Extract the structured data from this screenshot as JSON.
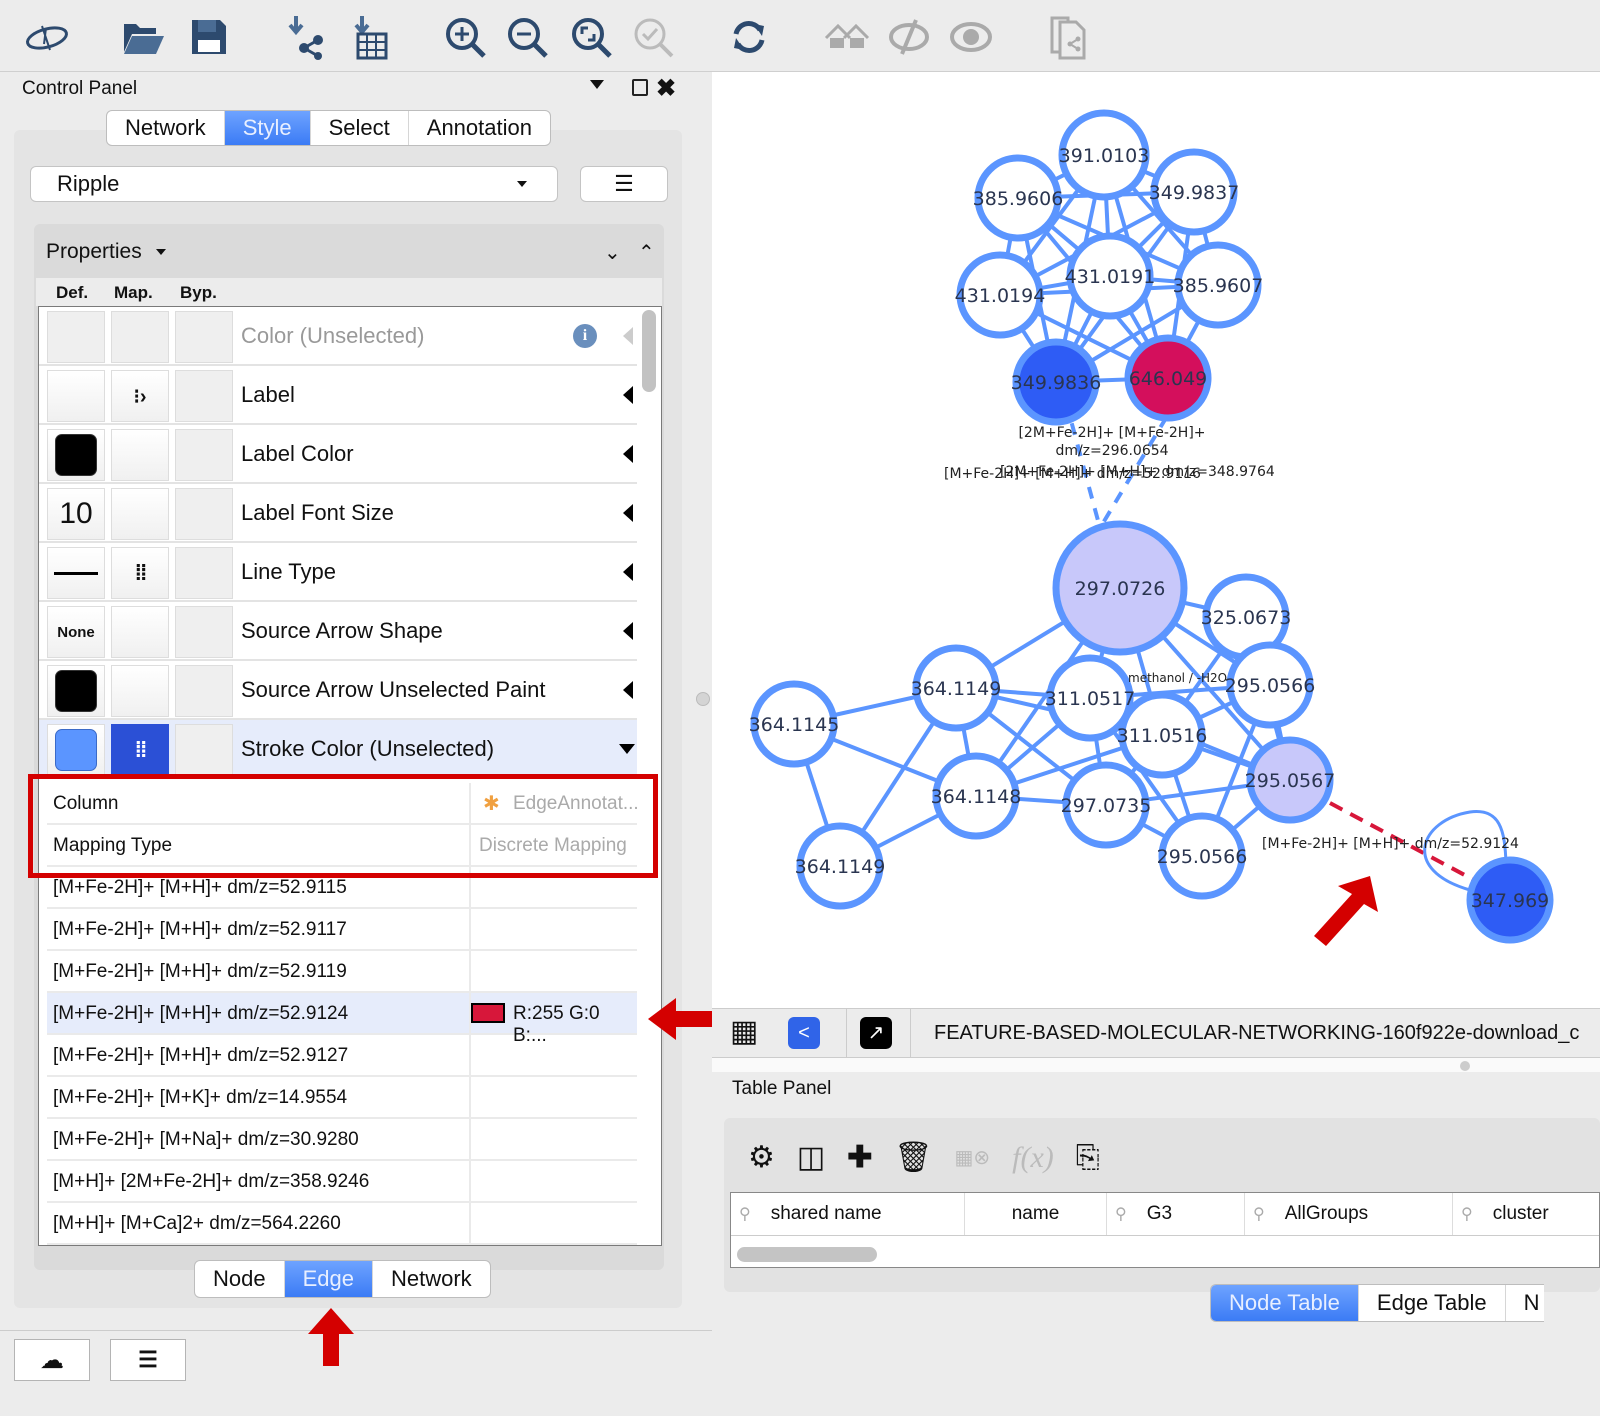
{
  "toolbar": {
    "icons": [
      "cytoscape-logo-icon",
      "open-folder-icon",
      "save-icon",
      "import-network-icon",
      "import-table-icon",
      "zoom-in-icon",
      "zoom-out-icon",
      "zoom-fit-icon",
      "zoom-selected-icon",
      "refresh-layout-icon",
      "home-icon",
      "hide-icon",
      "show-icon",
      "export-network-image-icon"
    ]
  },
  "control_panel": {
    "title": "Control Panel",
    "tabs": [
      {
        "label": "Network",
        "active": false
      },
      {
        "label": "Style",
        "active": true
      },
      {
        "label": "Select",
        "active": false
      },
      {
        "label": "Annotation",
        "active": false
      }
    ],
    "style_select": {
      "value": "Ripple"
    },
    "properties_label": "Properties",
    "column_headers": {
      "def": "Def.",
      "map": "Map.",
      "byp": "Byp."
    },
    "properties": [
      {
        "label": "Color (Unselected)",
        "def": "",
        "map": "",
        "disabled": true
      },
      {
        "label": "Label",
        "def": "",
        "map": "passthrough-mapping-icon"
      },
      {
        "label": "Label Color",
        "def": "#000000",
        "map": ""
      },
      {
        "label": "Label Font Size",
        "def": "10",
        "map": ""
      },
      {
        "label": "Line Type",
        "def": "solid-line",
        "map": "discrete-mapping-icon"
      },
      {
        "label": "Source Arrow Shape",
        "def": "None",
        "map": ""
      },
      {
        "label": "Source Arrow Unselected Paint",
        "def": "#000000",
        "map": ""
      },
      {
        "label": "Stroke Color (Unselected)",
        "def": "#5b95ff",
        "map": "discrete-mapping-icon",
        "expanded": true
      }
    ],
    "mapping_settings": [
      {
        "key": "Column",
        "value": "EdgeAnnotat..."
      },
      {
        "key": "Mapping Type",
        "value": "Discrete Mapping"
      }
    ],
    "mapping_entries": [
      {
        "key": "[M+Fe-2H]+ [M+H]+ dm/z=52.9115",
        "value": ""
      },
      {
        "key": "[M+Fe-2H]+ [M+H]+ dm/z=52.9117",
        "value": ""
      },
      {
        "key": "[M+Fe-2H]+ [M+H]+ dm/z=52.9119",
        "value": ""
      },
      {
        "key": "[M+Fe-2H]+ [M+H]+ dm/z=52.9124",
        "value": "R:255 G:0 B:...",
        "color": "#d7173a",
        "selected": true
      },
      {
        "key": "[M+Fe-2H]+ [M+H]+ dm/z=52.9127",
        "value": ""
      },
      {
        "key": "[M+Fe-2H]+ [M+K]+ dm/z=14.9554",
        "value": ""
      },
      {
        "key": "[M+Fe-2H]+ [M+Na]+ dm/z=30.9280",
        "value": ""
      },
      {
        "key": "[M+H]+ [2M+Fe-2H]+ dm/z=358.9246",
        "value": ""
      },
      {
        "key": "[M+H]+ [M+Ca]2+ dm/z=564.2260",
        "value": ""
      }
    ],
    "bottom_tabs": [
      {
        "label": "Node",
        "active": false
      },
      {
        "label": "Edge",
        "active": true
      },
      {
        "label": "Network",
        "active": false
      }
    ]
  },
  "network": {
    "nodes": [
      {
        "id": "n1",
        "label": "391.0103",
        "fill": "#ffffff"
      },
      {
        "id": "n2",
        "label": "385.9606",
        "fill": "#ffffff"
      },
      {
        "id": "n3",
        "label": "349.9837",
        "fill": "#ffffff"
      },
      {
        "id": "n4",
        "label": "431.0191",
        "fill": "#ffffff"
      },
      {
        "id": "n5",
        "label": "431.0194",
        "fill": "#ffffff"
      },
      {
        "id": "n6",
        "label": "385.9607",
        "fill": "#ffffff"
      },
      {
        "id": "n7",
        "label": "349.9836",
        "fill": "#2e5cf5"
      },
      {
        "id": "n8",
        "label": "646.049",
        "fill": "#d40f5c"
      },
      {
        "id": "n9",
        "label": "297.0726",
        "fill": "#c8c8fa"
      },
      {
        "id": "n10",
        "label": "325.0673",
        "fill": "#ffffff"
      },
      {
        "id": "n11",
        "label": "364.1149",
        "fill": "#ffffff"
      },
      {
        "id": "n12",
        "label": "311.0517",
        "fill": "#ffffff"
      },
      {
        "id": "n13",
        "label": "295.0566",
        "fill": "#ffffff"
      },
      {
        "id": "n14",
        "label": "364.1145",
        "fill": "#ffffff"
      },
      {
        "id": "n15",
        "label": "311.0516",
        "fill": "#ffffff"
      },
      {
        "id": "n16",
        "label": "364.1148",
        "fill": "#ffffff"
      },
      {
        "id": "n17",
        "label": "297.0735",
        "fill": "#ffffff"
      },
      {
        "id": "n18",
        "label": "295.0567",
        "fill": "#c8c8fa"
      },
      {
        "id": "n19",
        "label": "364.1149",
        "fill": "#ffffff"
      },
      {
        "id": "n20",
        "label": "295.0566",
        "fill": "#ffffff"
      },
      {
        "id": "n21",
        "label": "347.969",
        "fill": "#2e5cf5"
      }
    ],
    "edge_labels": [
      "[2M+Fe-2H]+ [M+Fe-2H]+",
      "dm/z=296.0654",
      "[M+Fe-2H]+ [M+H]+ dm/z=52.9116",
      "[2M+Fe-2H]+ [M+H]+ dm/z=348.9764",
      "methanol / -H2O",
      "[M+Fe-2H]+ [M+H]+ dm/z=52.9124"
    ],
    "highlighted_edge_color": "#d7173a",
    "default_edge_color": "#5b95ff"
  },
  "network_toolbar": {
    "title": "FEATURE-BASED-MOLECULAR-NETWORKING-160f922e-download_c"
  },
  "table_panel": {
    "title": "Table Panel",
    "columns": [
      "shared name",
      "name",
      "G3",
      "AllGroups",
      "cluster"
    ],
    "tabs": [
      {
        "label": "Node Table",
        "active": true
      },
      {
        "label": "Edge Table",
        "active": false
      },
      {
        "label": "N",
        "active": false
      }
    ]
  }
}
